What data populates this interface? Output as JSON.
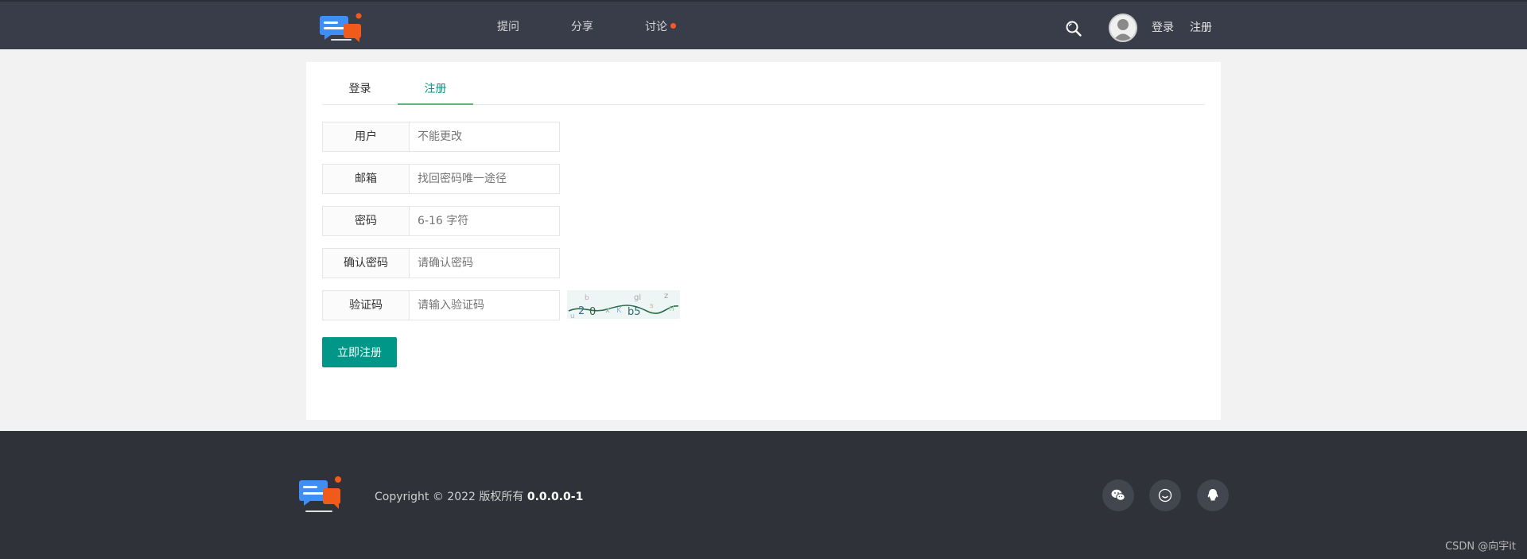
{
  "header": {
    "nav": [
      {
        "label": "提问",
        "dot": false
      },
      {
        "label": "分享",
        "dot": false
      },
      {
        "label": "讨论",
        "dot": true
      }
    ],
    "login_label": "登录",
    "register_label": "注册"
  },
  "tabs": [
    {
      "label": "登录",
      "active": false
    },
    {
      "label": "注册",
      "active": true
    }
  ],
  "form": {
    "fields": [
      {
        "label": "用户",
        "placeholder": "不能更改",
        "value": ""
      },
      {
        "label": "邮箱",
        "placeholder": "找回密码唯一途径",
        "value": ""
      },
      {
        "label": "密码",
        "placeholder": "6-16 字符",
        "value": ""
      },
      {
        "label": "确认密码",
        "placeholder": "请确认密码",
        "value": ""
      },
      {
        "label": "验证码",
        "placeholder": "请输入验证码",
        "value": ""
      }
    ],
    "submit_label": "立即注册"
  },
  "footer": {
    "copyright_text": "Copyright © 2022 版权所有",
    "version": "0.0.0.0-1",
    "social_icons": [
      "wechat-icon",
      "smile-icon",
      "qq-icon"
    ]
  },
  "watermark": "CSDN @向宇it",
  "colors": {
    "header_bg": "#393d49",
    "accent": "#009688",
    "tab_underline": "#5fb878",
    "notify_dot": "#ff5722",
    "footer_bg": "#2f3238"
  }
}
